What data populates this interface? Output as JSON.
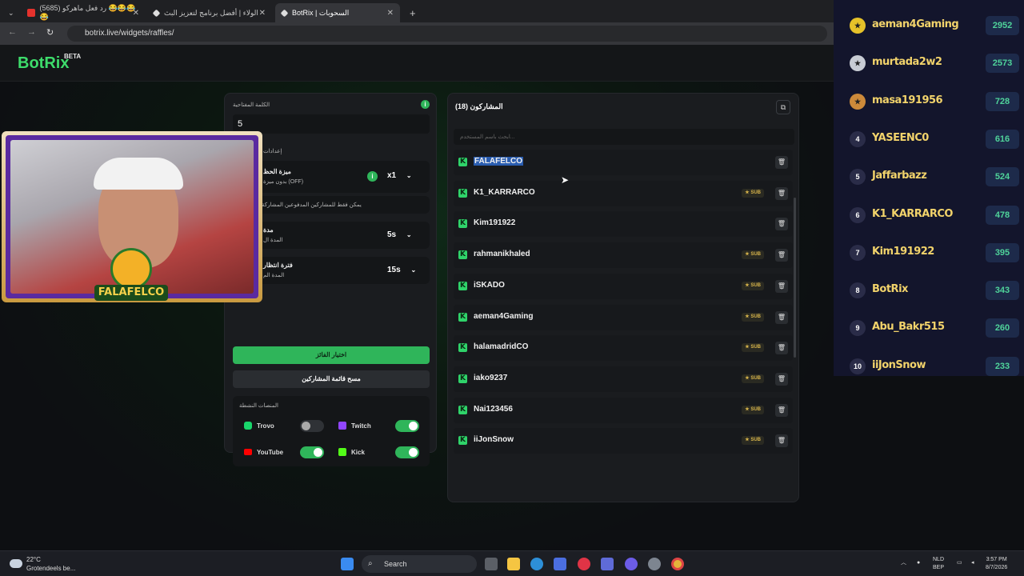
{
  "browser": {
    "tabs": [
      {
        "title": "(5685) رد فعل ماهركو 😂😂😂😂",
        "icon_color": "#e5322d"
      },
      {
        "title": "الولاء | أفضل برنامج لتعزيز البث",
        "icon_color": "#dddddd"
      },
      {
        "title": "BotRix | السحوبات",
        "icon_color": "#dddddd"
      }
    ],
    "new_tab": "+",
    "url": "botrix.live/widgets/raffles/"
  },
  "app": {
    "logo": "BotRix",
    "logo_badge": "BETA"
  },
  "settings": {
    "keyword_label": "الكلمة المفتاحية",
    "keyword_value": "5",
    "settings_label": "إعدادات",
    "luck_title": "ميزة الحظ",
    "luck_sub": "بدون ميزة (OFF)",
    "luck_value": "x1",
    "subs_only_text": "يمكن فقط للمشاركين المدفوعين المشاركة",
    "duration_title": "مدة",
    "duration_sub": "المدة ال",
    "duration_value": "5s",
    "wait_title": "فترة انتظار",
    "wait_sub": "المدة الم",
    "wait_value": "15s",
    "pick_winner": "اختيار الفائز",
    "clear_list": "مسح قائمة المشاركين",
    "platforms_label": "المنصات النشطة",
    "platforms": [
      {
        "name": "Trovo",
        "enabled": false,
        "color": "#19d66b"
      },
      {
        "name": "Twitch",
        "enabled": true,
        "color": "#9146ff"
      },
      {
        "name": "YouTube",
        "enabled": true,
        "color": "#ff0000"
      },
      {
        "name": "Kick",
        "enabled": true,
        "color": "#53fc18"
      }
    ]
  },
  "participants": {
    "title": "المشاركون (18)",
    "search_placeholder": "ابحث باسم المستخدم...",
    "sub_label": "SUB",
    "rows": [
      {
        "name": "FALAFELCO",
        "sub": false,
        "highlight": true
      },
      {
        "name": "K1_KARRARCO",
        "sub": true
      },
      {
        "name": "Kim191922",
        "sub": false
      },
      {
        "name": "rahmanikhaled",
        "sub": true
      },
      {
        "name": "iSKADO",
        "sub": true
      },
      {
        "name": "aeman4Gaming",
        "sub": true
      },
      {
        "name": "halamadridCO",
        "sub": true
      },
      {
        "name": "iako9237",
        "sub": true
      },
      {
        "name": "Nai123456",
        "sub": true
      },
      {
        "name": "iiJonSnow",
        "sub": true
      }
    ]
  },
  "overlay": {
    "streamer_name": "FALAFELCO"
  },
  "leaderboard": [
    {
      "rank": "1",
      "name": "aeman4Gaming",
      "score": "2952"
    },
    {
      "rank": "2",
      "name": "murtada2w2",
      "score": "2573"
    },
    {
      "rank": "3",
      "name": "masa191956",
      "score": "728"
    },
    {
      "rank": "4",
      "name": "YASEENC0",
      "score": "616"
    },
    {
      "rank": "5",
      "name": "Jaffarbazz",
      "score": "524"
    },
    {
      "rank": "6",
      "name": "K1_KARRARCO",
      "score": "478"
    },
    {
      "rank": "7",
      "name": "Kim191922",
      "score": "395"
    },
    {
      "rank": "8",
      "name": "BotRix",
      "score": "343"
    },
    {
      "rank": "9",
      "name": "Abu_Bakr515",
      "score": "260"
    },
    {
      "rank": "10",
      "name": "iiJonSnow",
      "score": "233"
    }
  ],
  "taskbar": {
    "temp": "22°C",
    "weather": "Grotendeels be...",
    "search": "Search",
    "lang1": "NLD",
    "lang2": "BEP",
    "time": "3:57 PM",
    "date": "8/7/2026"
  }
}
